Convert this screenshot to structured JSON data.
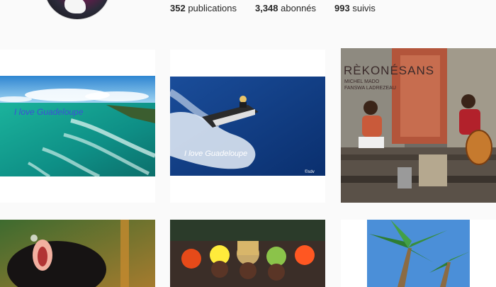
{
  "profile": {
    "stats": [
      {
        "count": "352",
        "label": "publications"
      },
      {
        "count": "3,348",
        "label": "abonnés"
      },
      {
        "count": "993",
        "label": "suivis"
      }
    ]
  },
  "posts": [
    {
      "overlay_text": "I love Guadeloupe"
    },
    {
      "overlay_text": "I love Guadeloupe",
      "credit": "©sdv"
    },
    {
      "title": "RÈKONÉSANS",
      "subtitle_line1": "MICHEL MADO",
      "subtitle_line2": "FANSWA LADREZEAU"
    },
    {},
    {},
    {}
  ],
  "colors": {
    "text": "#262626",
    "page_bg": "#fafafa"
  }
}
